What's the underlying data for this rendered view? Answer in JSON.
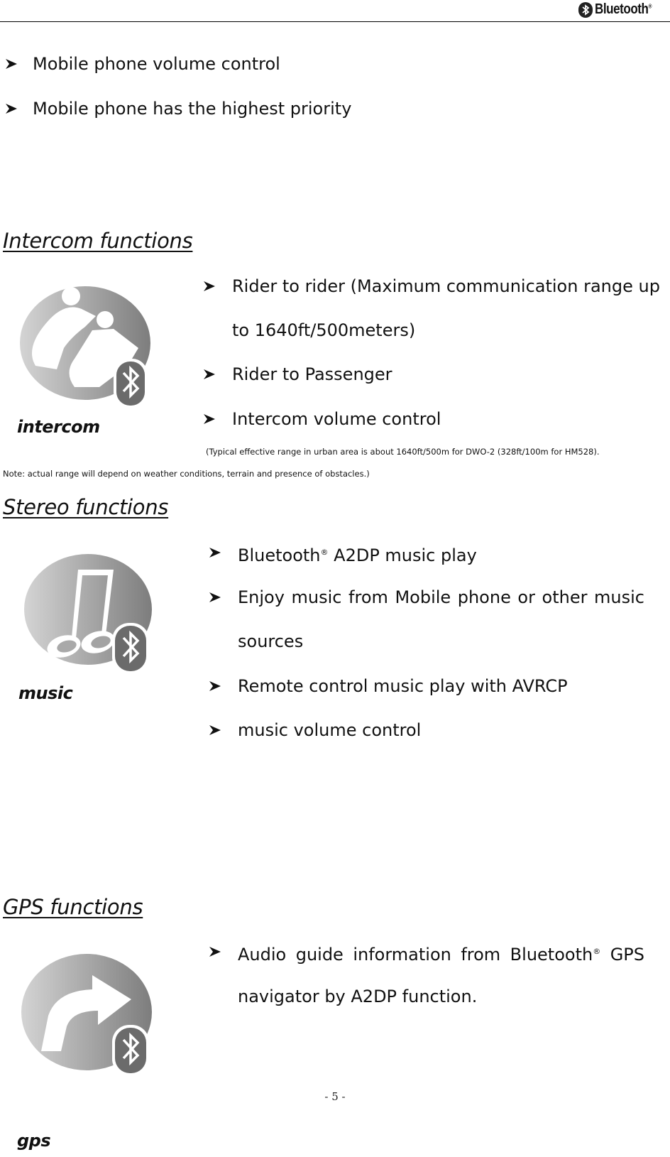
{
  "header": {
    "logo_text": "Bluetooth",
    "logo_mark": "®"
  },
  "intro_bullets": [
    "Mobile phone volume control",
    "Mobile phone has the highest priority"
  ],
  "sections": {
    "intercom": {
      "title": "Intercom functions",
      "icon": "intercom-riders-bluetooth-icon",
      "icon_label": "intercom",
      "bullets": [
        {
          "line1": "Rider to rider (Maximum communication range up",
          "line2": "to 1640ft/500meters)"
        },
        {
          "line1": "Rider to Passenger"
        },
        {
          "line1": "Intercom volume control"
        }
      ],
      "note_line1": "(Typical effective range in urban area is about 1640ft/500m for DWO-2 (328ft/100m for HM528).",
      "note_line2": "Note: actual range will depend on weather conditions, terrain and presence of obstacles.)"
    },
    "stereo": {
      "title": "Stereo functions",
      "icon": "music-note-bluetooth-icon",
      "icon_label": "music",
      "bullets": [
        {
          "pre": "Bluetooth",
          "sup": "®",
          "post": " A2DP music play"
        },
        {
          "line1": "Enjoy music from Mobile phone or other music",
          "line2": "sources"
        },
        {
          "line1": "Remote control music play with AVRCP"
        },
        {
          "line1": "music volume control"
        }
      ]
    },
    "gps": {
      "title": "GPS functions",
      "icon": "gps-turn-arrow-bluetooth-icon",
      "icon_label": "gps",
      "bullets": [
        {
          "pre": "Audio guide information from Bluetooth",
          "sup": "®",
          "post": " GPS",
          "line2": "navigator by A2DP function."
        }
      ]
    }
  },
  "footer": {
    "page_number": "- 5 -"
  }
}
